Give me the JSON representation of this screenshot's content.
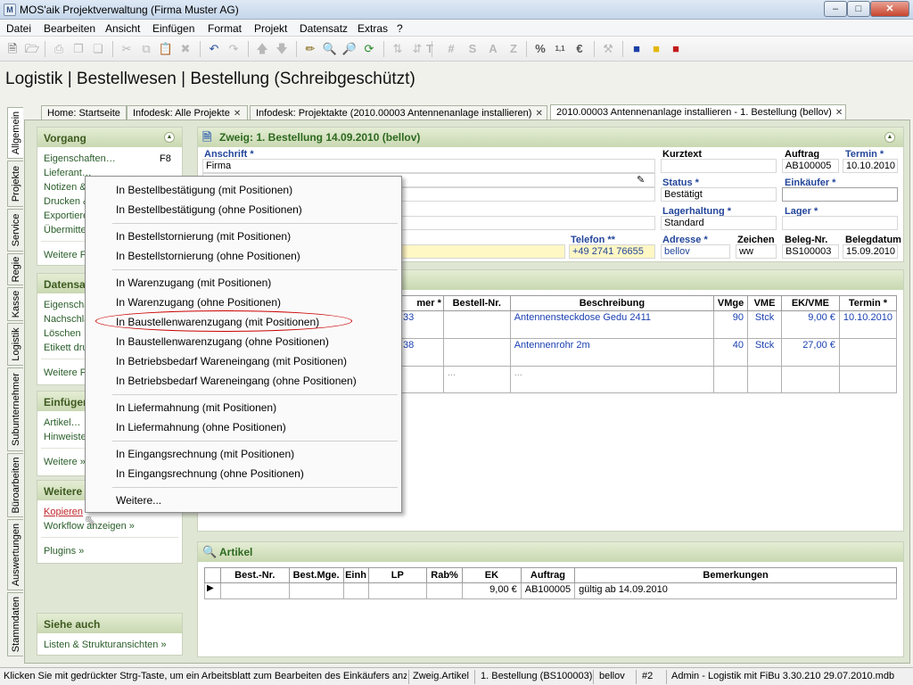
{
  "window": {
    "title": "MOS'aik Projektverwaltung (Firma Muster AG)"
  },
  "menu": [
    "Datei",
    "Bearbeiten",
    "Ansicht",
    "Einfügen",
    "Format",
    "Projekt",
    "Datensatz",
    "Extras",
    "?"
  ],
  "page_heading": "Logistik | Bestellwesen | Bestellung (Schreibgeschützt)",
  "doc_tabs": [
    {
      "label": "Home: Startseite"
    },
    {
      "label": "Infodesk: Alle Projekte"
    },
    {
      "label": "Infodesk: Projektakte (2010.00003 Antennenanlage installieren)"
    },
    {
      "label": "2010.00003 Antennenanlage installieren - 1. Bestellung (bellov)"
    }
  ],
  "side_tabs": [
    "Allgemein",
    "Projekte",
    "Service",
    "Regie",
    "Kasse",
    "Logistik",
    "Subunternehmer",
    "Büroarbeiten",
    "Auswertungen",
    "Stammdaten"
  ],
  "panels": {
    "vorgang": {
      "title": "Vorgang",
      "items": [
        "Eigenschaften…",
        "Lieferant…",
        "Notizen &",
        "Drucken &",
        "Exportiere",
        "Übermitte"
      ],
      "shortcut": "F8",
      "more": "Weitere F"
    },
    "datensatz": {
      "title": "Datensa",
      "items": [
        "Eigenscha",
        "Nachschla",
        "Löschen",
        "Etikett dru"
      ],
      "more": "Weitere F"
    },
    "einfuegen": {
      "title": "Einfügen",
      "items": [
        "Artikel…",
        "Hinweiste"
      ],
      "more": "Weitere »"
    },
    "weitere": {
      "title": "Weitere",
      "items": [
        "Kopieren",
        "Workflow anzeigen »"
      ],
      "plugins": "Plugins »"
    },
    "siehe": {
      "title": "Siehe auch",
      "items": [
        "Listen & Strukturansichten »"
      ]
    }
  },
  "zweig": {
    "title": "Zweig: 1. Bestellung 14.09.2010 (bellov)",
    "anschrift_label": "Anschrift *",
    "anschrift_value": "Firma",
    "kurztext_label": "Kurztext",
    "auftrag_label": "Auftrag",
    "auftrag_value": "AB100005",
    "termin_label": "Termin *",
    "termin_value": "10.10.2010",
    "status_label": "Status *",
    "status_value": "Bestätigt",
    "einkaeufer_label": "Einkäufer *",
    "lagerhaltung_label": "Lagerhaltung *",
    "lagerhaltung_value": "Standard",
    "lager_label": "Lager *",
    "telefon_label": "Telefon **",
    "telefon_value": "+49 2741 76655",
    "adresse_label": "Adresse *",
    "adresse_value": "bellov",
    "zeichen_label": "Zeichen",
    "zeichen_value": "ww",
    "belegnr_label": "Beleg-Nr.",
    "belegnr_value": "BS100003",
    "belegdatum_label": "Belegdatum",
    "belegdatum_value": "15.09.2010"
  },
  "positions": {
    "headers": [
      "mer *",
      "Bestell-Nr.",
      "Beschreibung",
      "VMge",
      "VME",
      "EK/VME",
      "Termin *"
    ],
    "rows": [
      [
        "33",
        "",
        "Antennensteckdose Gedu 2411",
        "90",
        "Stck",
        "9,00 €",
        "10.10.2010"
      ],
      [
        "38",
        "",
        "Antennenrohr 2m",
        "40",
        "Stck",
        "27,00 €",
        ""
      ],
      [
        "",
        "...",
        "...",
        "",
        "",
        "",
        ""
      ]
    ]
  },
  "artikel": {
    "title": "Artikel",
    "headers": [
      "Best.-Nr.",
      "Best.Mge.",
      "Einh",
      "LP",
      "Rab%",
      "EK",
      "Auftrag",
      "Bemerkungen"
    ],
    "rows": [
      [
        "",
        "",
        "",
        "",
        "",
        "9,00 €",
        "AB100005",
        "gültig ab 14.09.2010"
      ]
    ]
  },
  "context_menu": {
    "groups": [
      [
        "In Bestellbestätigung (mit Positionen)",
        "In Bestellbestätigung (ohne Positionen)"
      ],
      [
        "In Bestellstornierung (mit Positionen)",
        "In Bestellstornierung (ohne Positionen)"
      ],
      [
        "In Warenzugang (mit Positionen)",
        "In Warenzugang (ohne Positionen)",
        "In Baustellenwarenzugang (mit Positionen)",
        "In Baustellenwarenzugang (ohne Positionen)",
        "In Betriebsbedarf Wareneingang (mit Positionen)",
        "In Betriebsbedarf Wareneingang (ohne Positionen)"
      ],
      [
        "In Liefermahnung (mit Positionen)",
        "In Liefermahnung (ohne Positionen)"
      ],
      [
        "In Eingangsrechnung (mit Positionen)",
        "In Eingangsrechnung (ohne Positionen)"
      ],
      [
        "Weitere..."
      ]
    ],
    "highlighted": "In Baustellenwarenzugang (mit Positionen)"
  },
  "statusbar": {
    "hint": "Klicken Sie mit gedrückter Strg-Taste, um ein Arbeitsblatt zum Bearbeiten des Einkäufers anzuz",
    "context": "Zweig.Artikel",
    "record": "1. Bestellung (BS100003)",
    "user": "bellov",
    "num": "#2",
    "info": "Admin - Logistik mit FiBu 3.30.210 29.07.2010.mdb"
  }
}
